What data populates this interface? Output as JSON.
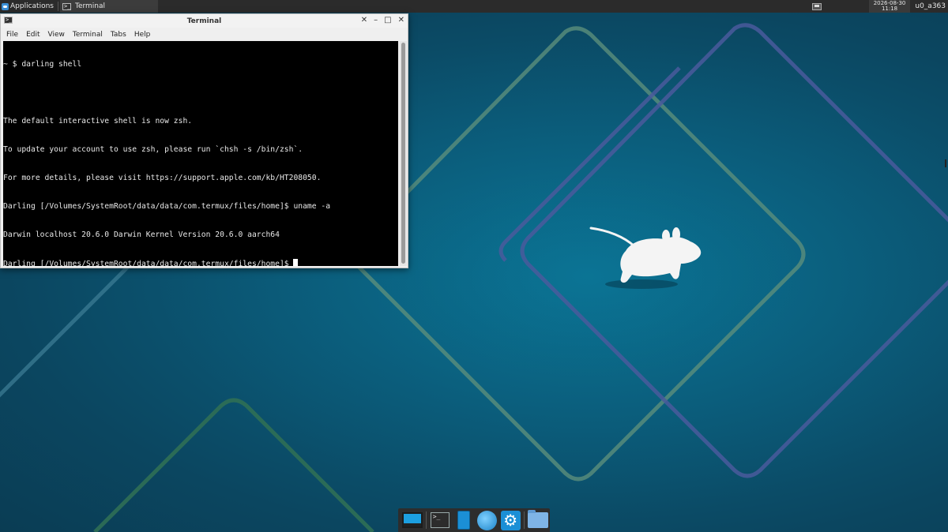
{
  "top_panel": {
    "applications_label": "Applications",
    "task_label": "Terminal",
    "clock_date": "2026-08-30",
    "clock_time": "11:18",
    "user": "u0_a363"
  },
  "terminal": {
    "window_title": "Terminal",
    "menu": [
      "File",
      "Edit",
      "View",
      "Terminal",
      "Tabs",
      "Help"
    ],
    "controls": {
      "menu": "✕",
      "minimize": "–",
      "maximize": "□",
      "close": "✕"
    },
    "lines": [
      "~ $ darling shell",
      "",
      "The default interactive shell is now zsh.",
      "To update your account to use zsh, please run `chsh -s /bin/zsh`.",
      "For more details, please visit https://support.apple.com/kb/HT208050.",
      "Darling [/Volumes/SystemRoot/data/data/com.termux/files/home]$ uname -a",
      "Darwin localhost 20.6.0 Darwin Kernel Version 20.6.0 aarch64",
      "Darling [/Volumes/SystemRoot/data/data/com.termux/files/home]$ "
    ]
  },
  "dock": {
    "items": [
      "show-desktop-icon",
      "terminal-icon",
      "phone-icon",
      "web-browser-icon",
      "settings-icon",
      "file-manager-icon"
    ]
  },
  "colors": {
    "panel_bg": "#2b2b2b",
    "wallpaper": "#0b5a78",
    "accent": "#1c9fe0"
  }
}
